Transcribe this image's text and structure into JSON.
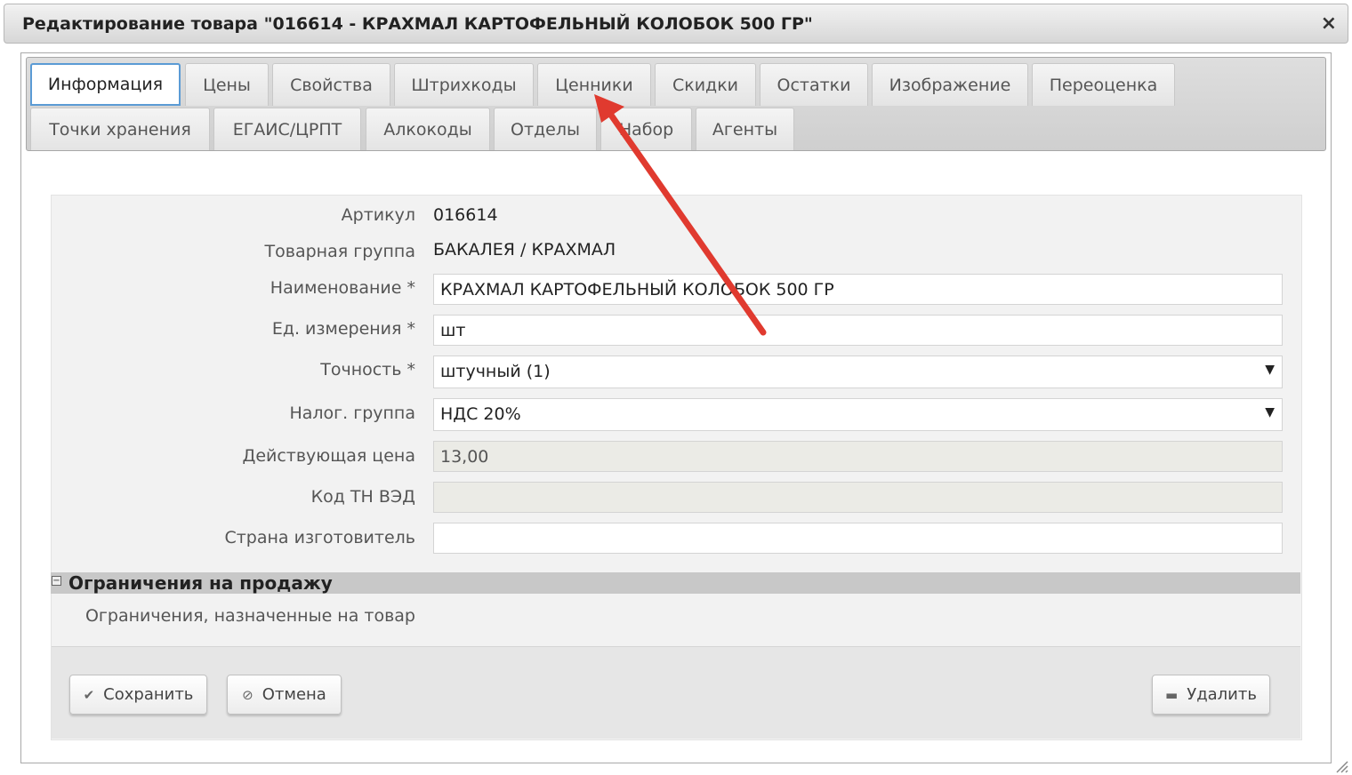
{
  "window": {
    "title": "Редактирование товара \"016614 - КРАХМАЛ КАРТОФЕЛЬНЫЙ КОЛОБОК 500 ГР\"",
    "close_glyph": "×"
  },
  "tabs": {
    "row1": [
      "Информация",
      "Цены",
      "Свойства",
      "Штрихкоды",
      "Ценники",
      "Скидки",
      "Остатки",
      "Изображение",
      "Переоценка"
    ],
    "row2": [
      "Точки хранения",
      "ЕГАИС/ЦРПТ",
      "Алкокоды",
      "Отделы",
      "Набор",
      "Агенты"
    ],
    "active": "Информация"
  },
  "form": {
    "article_label": "Артикул",
    "article_value": "016614",
    "group_label": "Товарная группа",
    "group_value": "БАКАЛЕЯ / КРАХМАЛ",
    "name_label": "Наименование *",
    "name_value": "КРАХМАЛ КАРТОФЕЛЬНЫЙ КОЛОБОК 500 ГР",
    "unit_label": "Ед. измерения *",
    "unit_value": "шт",
    "precision_label": "Точность *",
    "precision_value": "штучный (1)",
    "tax_label": "Налог. группа",
    "tax_value": "НДС 20%",
    "price_label": "Действующая цена",
    "price_value": "13,00",
    "tnved_label": "Код ТН ВЭД",
    "tnved_value": "",
    "country_label": "Страна изготовитель",
    "country_value": ""
  },
  "restrictions": {
    "section_title": "Ограничения на продажу",
    "toggle_glyph": "−",
    "note": "Ограничения, назначенные на товар"
  },
  "buttons": {
    "save": "Сохранить",
    "cancel": "Отмена",
    "delete": "Удалить"
  },
  "colors": {
    "annotation_arrow": "#e03a2f",
    "active_tab_border": "#5b9bd5"
  }
}
